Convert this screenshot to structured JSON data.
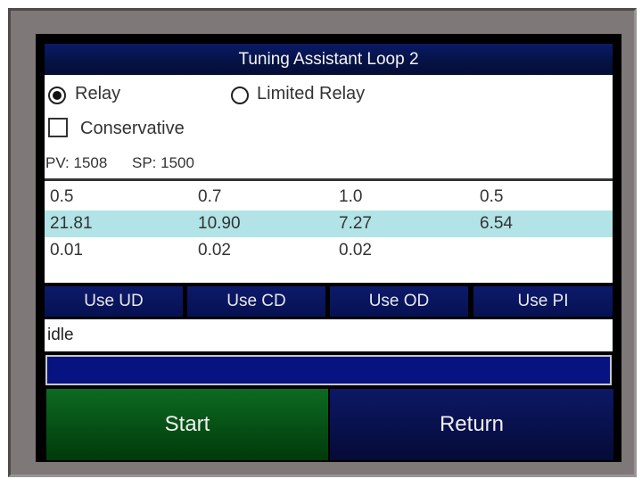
{
  "title": "Tuning Assistant Loop 2",
  "options": {
    "relay_label": "Relay",
    "relay_selected": true,
    "limited_relay_label": "Limited Relay",
    "limited_relay_selected": false,
    "conservative_label": "Conservative",
    "conservative_checked": false,
    "pv_text": "PV: 1508",
    "sp_text": "SP: 1500"
  },
  "table": {
    "rows": [
      [
        "0.5",
        "0.7",
        "1.0",
        "0.5"
      ],
      [
        "21.81",
        "10.90",
        "7.27",
        "6.54"
      ],
      [
        "0.01",
        "0.02",
        "0.02",
        ""
      ]
    ],
    "highlighted_row": 1
  },
  "buttons": {
    "use_ud": "Use UD",
    "use_cd": "Use CD",
    "use_od": "Use OD",
    "use_pi": "Use PI",
    "start": "Start",
    "return": "Return"
  },
  "status": "idle",
  "progress_percent": 0,
  "colors": {
    "header_blue": "#051244",
    "highlight_row": "#b2e3e6",
    "start_green": "#0d6a22",
    "progress_bg": "#061380"
  }
}
